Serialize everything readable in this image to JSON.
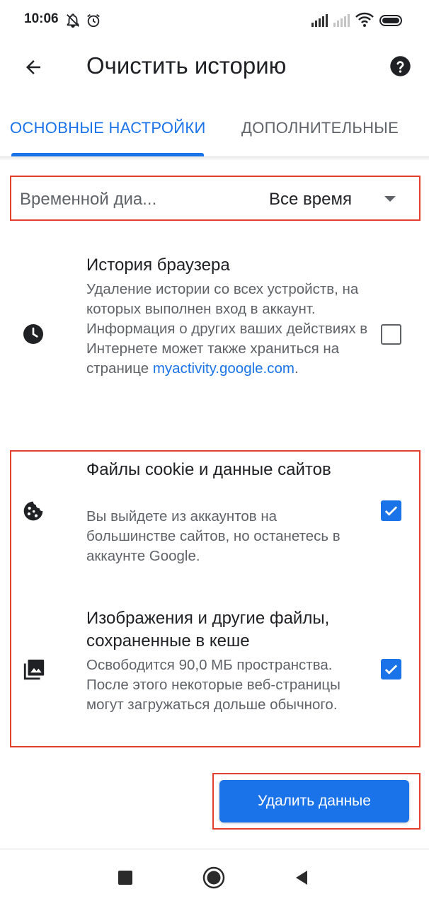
{
  "status_bar": {
    "time": "10:06",
    "icons": [
      "notifications-off-icon",
      "alarm-icon",
      "signal-icon",
      "signal-no-sim-icon",
      "wifi-icon",
      "battery-icon"
    ]
  },
  "app_bar": {
    "title": "Очистить историю",
    "back_icon": "arrow-left-icon",
    "help_icon": "help-icon"
  },
  "tabs": [
    {
      "label": "ОСНОВНЫЕ НАСТРОЙКИ",
      "active": true
    },
    {
      "label": "ДОПОЛНИТЕЛЬНЫЕ",
      "active": false
    }
  ],
  "time_range": {
    "label": "Временной диа...",
    "value": "Все время"
  },
  "options": [
    {
      "icon": "clock-icon",
      "title": "История браузера",
      "description": "Удаление истории со всех устройств, на которых выполнен вход в аккаунт. Информация о других ваших действиях в Интернете может также храниться на странице",
      "link": "myactivity.google.com",
      "link_suffix": ".",
      "checked": false
    },
    {
      "icon": "cookie-icon",
      "title": "Файлы cookie и данные сайтов",
      "description": "Вы выйдете из аккаунтов на большинстве сайтов, но останетесь в аккаунте Google.",
      "checked": true
    },
    {
      "icon": "images-icon",
      "title": "Изображения и другие файлы, сохраненные в кеше",
      "description": "Освободится 90,0 МБ пространства. После этого некоторые веб-страницы могут загружаться дольше обычного.",
      "checked": true
    }
  ],
  "action_button": {
    "label": "Удалить данные"
  },
  "colors": {
    "accent": "#1a73e8",
    "highlight": "#e53f2f",
    "text_primary": "#202124",
    "text_secondary": "#5f6368"
  },
  "nav_bar": {
    "icons": [
      "recents-square-icon",
      "home-circle-icon",
      "back-triangle-icon"
    ]
  }
}
